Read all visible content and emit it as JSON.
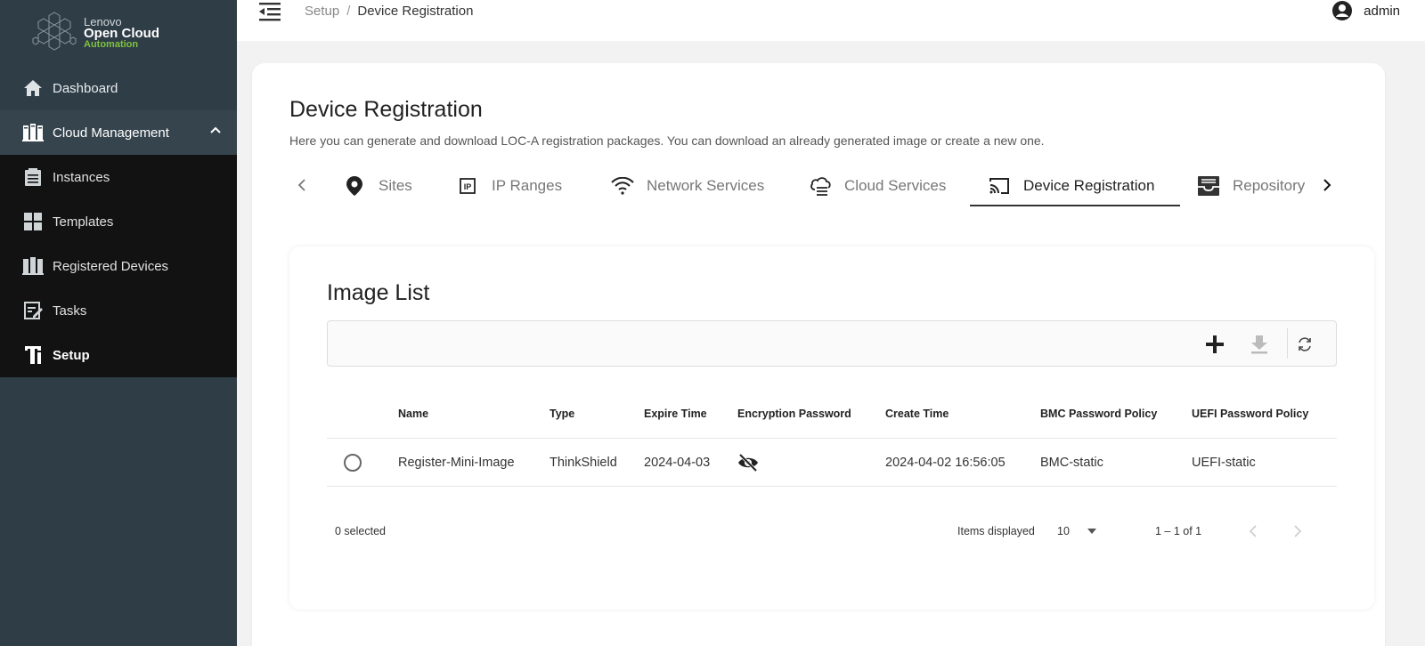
{
  "brand": {
    "line1": "Lenovo",
    "line2": "Open Cloud",
    "line3": "Automation"
  },
  "sidebar": {
    "items": [
      {
        "label": "Dashboard",
        "icon": "home-icon"
      },
      {
        "label": "Cloud Management",
        "icon": "cloud-management-icon",
        "expanded": true
      },
      {
        "label": "Instances",
        "icon": "instances-icon"
      },
      {
        "label": "Templates",
        "icon": "templates-icon"
      },
      {
        "label": "Registered Devices",
        "icon": "registered-devices-icon"
      },
      {
        "label": "Tasks",
        "icon": "tasks-icon"
      },
      {
        "label": "Setup",
        "icon": "setup-icon",
        "active": true
      }
    ]
  },
  "header": {
    "breadcrumb": [
      "Setup",
      "/",
      "Device Registration"
    ],
    "user": "admin"
  },
  "page": {
    "title": "Device Registration",
    "description": "Here you can generate and download LOC-A registration packages. You can download an already generated image or create a new one."
  },
  "tabs": [
    {
      "label": "Sites",
      "icon": "location-pin-icon"
    },
    {
      "label": "IP Ranges",
      "icon": "ip-icon"
    },
    {
      "label": "Network Services",
      "icon": "wifi-icon"
    },
    {
      "label": "Cloud Services",
      "icon": "cloud-services-icon"
    },
    {
      "label": "Device Registration",
      "icon": "cast-icon",
      "active": true
    },
    {
      "label": "Repository",
      "icon": "repository-icon"
    }
  ],
  "image_list": {
    "title": "Image List",
    "columns": [
      "Name",
      "Type",
      "Expire Time",
      "Encryption Password",
      "Create Time",
      "BMC Password Policy",
      "UEFI Password Policy"
    ],
    "rows": [
      {
        "name": "Register-Mini-Image",
        "type": "ThinkShield",
        "expire_time": "2024-04-03",
        "encryption_password": "hidden",
        "create_time": "2024-04-02 16:56:05",
        "bmc_policy": "BMC-static",
        "uefi_policy": "UEFI-static"
      }
    ],
    "selected_text": "0 selected",
    "items_displayed_label": "Items displayed",
    "items_displayed_value": "10",
    "range_text": "1 – 1 of 1"
  },
  "colors": {
    "sidebar_bg": "#2f3d47",
    "sidebar_sub_bg": "#121212",
    "brand_green": "#7fc241",
    "tab_active": "#333333"
  }
}
